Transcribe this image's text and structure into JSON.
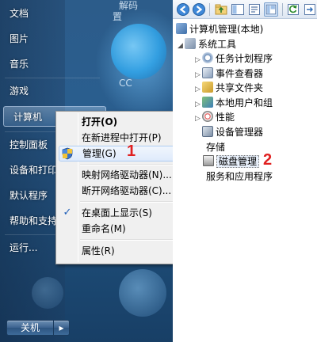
{
  "start_menu": {
    "items": [
      {
        "label": "文档"
      },
      {
        "label": "图片"
      },
      {
        "label": "音乐"
      },
      {
        "label": "游戏"
      },
      {
        "label": "计算机"
      },
      {
        "label": "控制面板"
      },
      {
        "label": "设备和打印"
      },
      {
        "label": "默认程序"
      },
      {
        "label": "帮助和支持"
      },
      {
        "label": "运行..."
      }
    ],
    "shutdown_label": "关机",
    "shutdown_arrow": "▸"
  },
  "desktop": {
    "fragment_1": "解码",
    "fragment_2": "置",
    "fragment_3": "CC"
  },
  "context_menu": {
    "items": [
      {
        "label": "打开(O)",
        "bold": true
      },
      {
        "label": "在新进程中打开(P)"
      },
      {
        "label": "管理(G)",
        "hover": true
      },
      {
        "label": "映射网络驱动器(N)..."
      },
      {
        "label": "断开网络驱动器(C)..."
      },
      {
        "label": "在桌面上显示(S)",
        "checked": true
      },
      {
        "label": "重命名(M)"
      },
      {
        "label": "属性(R)"
      }
    ],
    "check_mark": "✓"
  },
  "annotations": {
    "step1": "1",
    "step2": "2"
  },
  "mmc": {
    "toolbar_icons": [
      "back-arrow-icon",
      "forward-arrow-icon",
      "folder-up-icon",
      "show-hide-tree-icon",
      "properties-icon",
      "help-icon",
      "refresh-icon",
      "export-icon"
    ],
    "tree": {
      "root": "计算机管理(本地)",
      "system_tools": "系统工具",
      "system_children": [
        "任务计划程序",
        "事件查看器",
        "共享文件夹",
        "本地用户和组",
        "性能",
        "设备管理器"
      ],
      "storage": "存储",
      "disk_management": "磁盘管理",
      "services": "服务和应用程序"
    }
  },
  "colors": {
    "accent_red": "#e02020",
    "hover_border": "#aeccf1"
  }
}
